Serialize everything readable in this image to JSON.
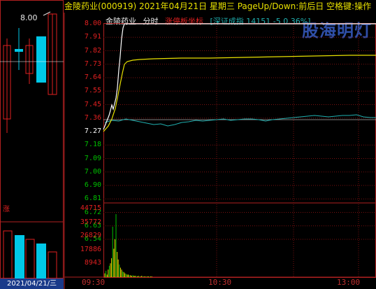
{
  "title_bar": {
    "text": "金陵药业(000919)  2021年04月21日 星期三 PageUp/Down:前后日 空格键:操作"
  },
  "watermark": {
    "text": "股海明灯"
  },
  "info_line": {
    "stock_name": "金陵药业",
    "mode": "分时",
    "indicator": "涨停板坐标",
    "index_info": "[深证成指 14151 -5 0.36%]"
  },
  "daily_panel": {
    "price_tag": "8.00",
    "zhang_label": "涨",
    "date_label": "2021/04/21/三"
  },
  "price_axis": [
    "8.00",
    "7.91",
    "7.82",
    "7.73",
    "7.64",
    "7.55",
    "7.45",
    "7.36",
    "7.27",
    "7.18",
    "7.09",
    "7.00",
    "6.90",
    "6.81",
    "6.72",
    "6.63",
    "6.54"
  ],
  "volume_axis": [
    "44715",
    "35772",
    "26829",
    "17886",
    "8943"
  ],
  "time_axis": [
    "09:30",
    "10:30",
    "13:00"
  ],
  "colors": {
    "up": "#e02020",
    "down": "#00c8e8",
    "price_line": "#ffffff",
    "avg_line": "#e8e000",
    "index_line": "#20b0b0",
    "grid": "#7a1010"
  },
  "chart_data": {
    "type": "line",
    "title": "",
    "series": [
      {
        "name": "price",
        "values": [
          7.15,
          7.2,
          7.3,
          7.4,
          7.7,
          8.0,
          8.0,
          8.0,
          8.0,
          8.0,
          8.0,
          8.0,
          8.0,
          8.0,
          8.0,
          8.0,
          8.0,
          8.0,
          8.0,
          8.0
        ]
      },
      {
        "name": "avg",
        "values": [
          7.15,
          7.2,
          7.3,
          7.5,
          7.7,
          7.74,
          7.75,
          7.76,
          7.76,
          7.76,
          7.77,
          7.77,
          7.77,
          7.77,
          7.77,
          7.78,
          7.78,
          7.78,
          7.78,
          7.78
        ]
      }
    ],
    "ylim": [
      6.54,
      8.0
    ]
  }
}
